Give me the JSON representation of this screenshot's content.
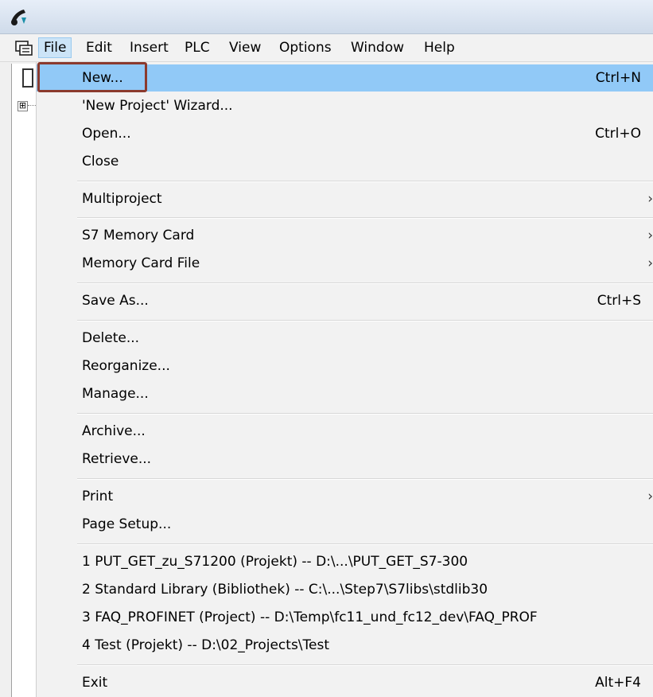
{
  "titlebar": {
    "icon": "simatic-manager-icon"
  },
  "menubar": {
    "icon": "project-toolbar-icon",
    "items": [
      {
        "label": "File",
        "active": true
      },
      {
        "label": "Edit"
      },
      {
        "label": "Insert"
      },
      {
        "label": "PLC"
      },
      {
        "label": "View"
      },
      {
        "label": "Options"
      },
      {
        "label": "Window"
      },
      {
        "label": "Help"
      }
    ]
  },
  "tree": {
    "expander": "⊞"
  },
  "file_menu": {
    "items": [
      {
        "label": "New...",
        "shortcut": "Ctrl+N",
        "highlighted": true
      },
      {
        "label": "'New Project' Wizard..."
      },
      {
        "label": "Open...",
        "shortcut": "Ctrl+O"
      },
      {
        "label": "Close"
      },
      {
        "label": "Multiproject",
        "submenu": true
      },
      {
        "label": "S7 Memory Card",
        "submenu": true
      },
      {
        "label": "Memory Card File",
        "submenu": true
      },
      {
        "label": "Save As...",
        "shortcut": "Ctrl+S"
      },
      {
        "label": "Delete..."
      },
      {
        "label": "Reorganize..."
      },
      {
        "label": "Manage..."
      },
      {
        "label": "Archive..."
      },
      {
        "label": "Retrieve..."
      },
      {
        "label": "Print",
        "submenu": true
      },
      {
        "label": "Page Setup..."
      },
      {
        "label": "1 PUT_GET_zu_S71200 (Projekt) -- D:\\...\\PUT_GET_S7-300"
      },
      {
        "label": "2 Standard Library (Bibliothek) -- C:\\...\\Step7\\S7libs\\stdlib30"
      },
      {
        "label": "3 FAQ_PROFINET (Project) -- D:\\Temp\\fc11_und_fc12_dev\\FAQ_PROF"
      },
      {
        "label": "4 Test (Projekt) -- D:\\02_Projects\\Test"
      },
      {
        "label": "Exit",
        "shortcut": "Alt+F4"
      }
    ],
    "submenu_arrow": "›"
  },
  "colors": {
    "highlight": "#91c9f7",
    "callout": "#8b3a2e",
    "menu_bg": "#f2f2f2"
  }
}
